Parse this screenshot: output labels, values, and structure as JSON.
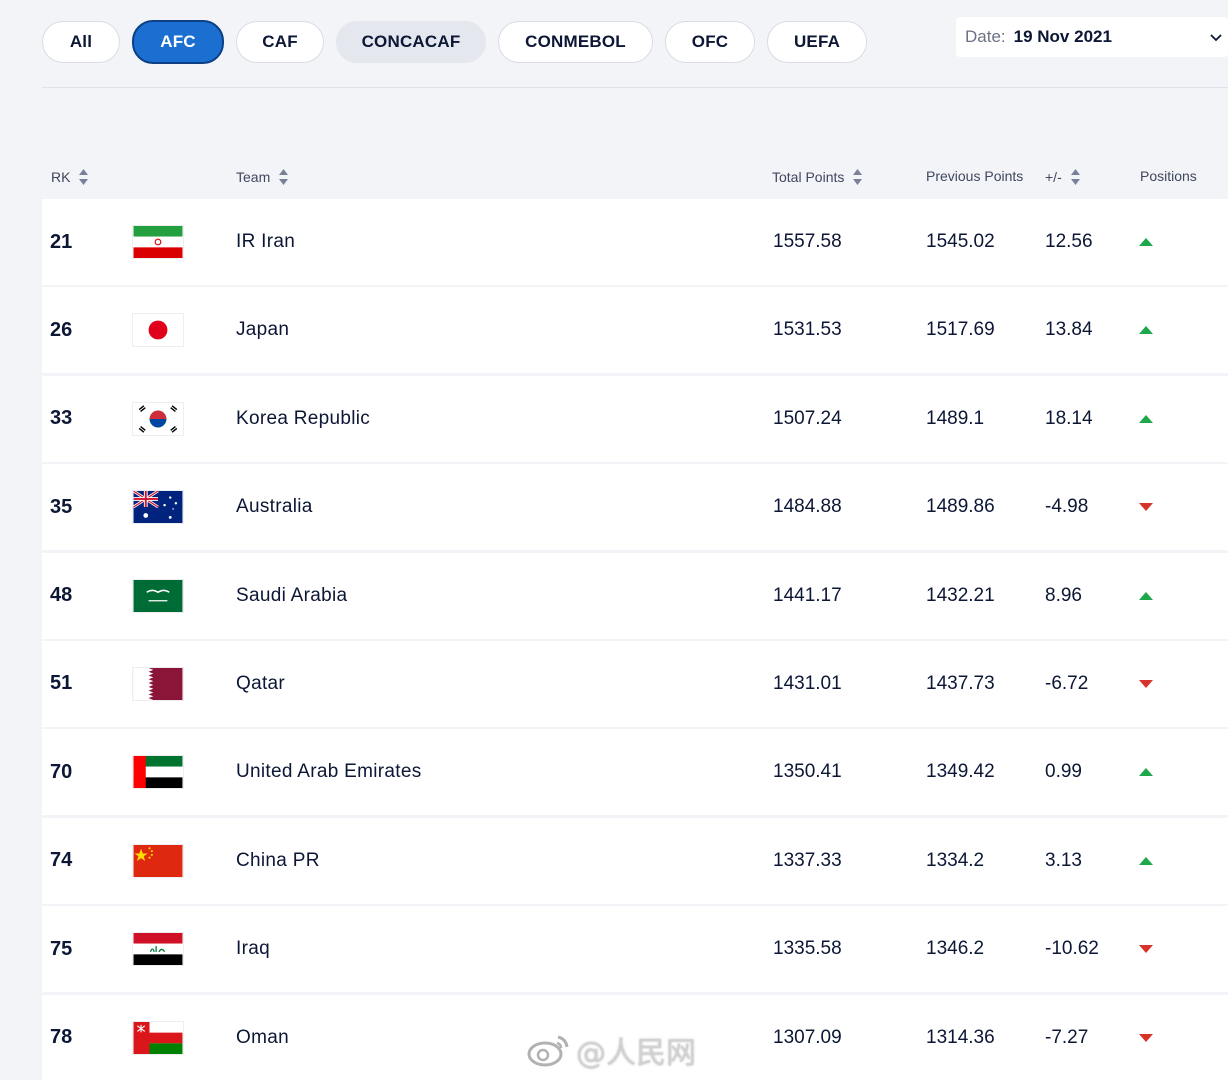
{
  "filters": {
    "tabs": [
      {
        "label": "All"
      },
      {
        "label": "AFC"
      },
      {
        "label": "CAF"
      },
      {
        "label": "CONCACAF"
      },
      {
        "label": "CONMEBOL"
      },
      {
        "label": "OFC"
      },
      {
        "label": "UEFA"
      }
    ],
    "active": "AFC",
    "hovered": "CONCACAF"
  },
  "date": {
    "label": "Date:",
    "value": "19 Nov 2021"
  },
  "table": {
    "headers": {
      "rank": "RK",
      "team": "Team",
      "total": "Total Points",
      "previous": "Previous Points",
      "diff": "+/-",
      "positions": "Positions"
    },
    "rows": [
      {
        "rank": "21",
        "team": "IR Iran",
        "flag": "iran-flag-icon",
        "total": "1557.58",
        "previous": "1545.02",
        "diff": "12.56",
        "trend": "up"
      },
      {
        "rank": "26",
        "team": "Japan",
        "flag": "japan-flag-icon",
        "total": "1531.53",
        "previous": "1517.69",
        "diff": "13.84",
        "trend": "up"
      },
      {
        "rank": "33",
        "team": "Korea Republic",
        "flag": "korea-flag-icon",
        "total": "1507.24",
        "previous": "1489.1",
        "diff": "18.14",
        "trend": "up"
      },
      {
        "rank": "35",
        "team": "Australia",
        "flag": "australia-flag-icon",
        "total": "1484.88",
        "previous": "1489.86",
        "diff": "-4.98",
        "trend": "down"
      },
      {
        "rank": "48",
        "team": "Saudi Arabia",
        "flag": "saudi-flag-icon",
        "total": "1441.17",
        "previous": "1432.21",
        "diff": "8.96",
        "trend": "up"
      },
      {
        "rank": "51",
        "team": "Qatar",
        "flag": "qatar-flag-icon",
        "total": "1431.01",
        "previous": "1437.73",
        "diff": "-6.72",
        "trend": "down"
      },
      {
        "rank": "70",
        "team": "United Arab Emirates",
        "flag": "uae-flag-icon",
        "total": "1350.41",
        "previous": "1349.42",
        "diff": "0.99",
        "trend": "up"
      },
      {
        "rank": "74",
        "team": "China PR",
        "flag": "china-flag-icon",
        "total": "1337.33",
        "previous": "1334.2",
        "diff": "3.13",
        "trend": "up"
      },
      {
        "rank": "75",
        "team": "Iraq",
        "flag": "iraq-flag-icon",
        "total": "1335.58",
        "previous": "1346.2",
        "diff": "-10.62",
        "trend": "down"
      },
      {
        "rank": "78",
        "team": "Oman",
        "flag": "oman-flag-icon",
        "total": "1307.09",
        "previous": "1314.36",
        "diff": "-7.27",
        "trend": "down"
      }
    ]
  },
  "watermark": {
    "text": "@人民网"
  },
  "colors": {
    "accent": "#1a6fd0",
    "up": "#1fa84b",
    "down": "#d6332b",
    "text": "#0c1635"
  }
}
